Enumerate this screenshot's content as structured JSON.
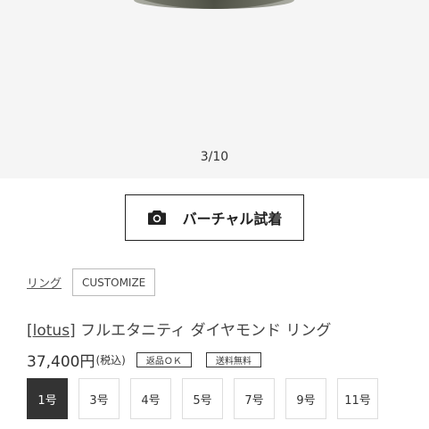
{
  "gallery": {
    "counter": "3/10"
  },
  "virtual_try_on": {
    "label": "バーチャル試着",
    "icon": "camera-icon"
  },
  "category": {
    "link_label": "リング",
    "tag_label": "CUSTOMIZE"
  },
  "product": {
    "brand": "[lotus]",
    "name": " フルエタニティ ダイヤモンド リング",
    "price": "37,400円",
    "tax_note": "(税込)",
    "badges": {
      "return": "返品ＯＫ",
      "shipping": "送料無料"
    }
  },
  "sizes": {
    "selected": "1号",
    "options": [
      "1号",
      "3号",
      "4号",
      "5号",
      "7号",
      "9号",
      "11号"
    ]
  }
}
